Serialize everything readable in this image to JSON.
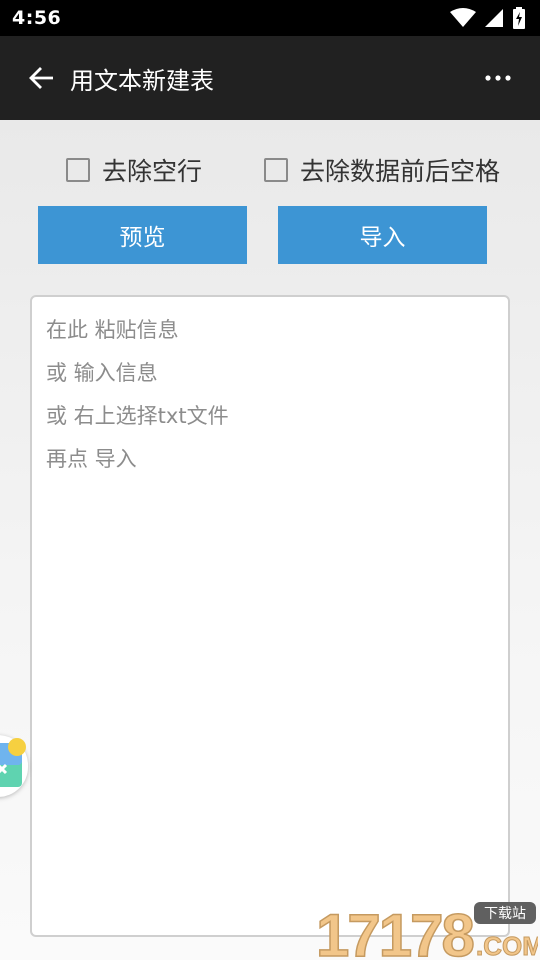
{
  "status_bar": {
    "time": "4:56"
  },
  "toolbar": {
    "title": "用文本新建表"
  },
  "options": {
    "remove_empty_lines": "去除空行",
    "trim_spaces": "去除数据前后空格"
  },
  "buttons": {
    "preview": "预览",
    "import": "导入"
  },
  "editor": {
    "placeholder_lines": [
      "在此 粘贴信息",
      "或 输入信息",
      "或 右上选择txt文件",
      "再点 导入"
    ]
  },
  "watermark": {
    "number": "17178",
    "tag": "下载站",
    "suffix": ".COM"
  },
  "colors": {
    "accent": "#3d95d4",
    "toolbar": "#212121"
  }
}
